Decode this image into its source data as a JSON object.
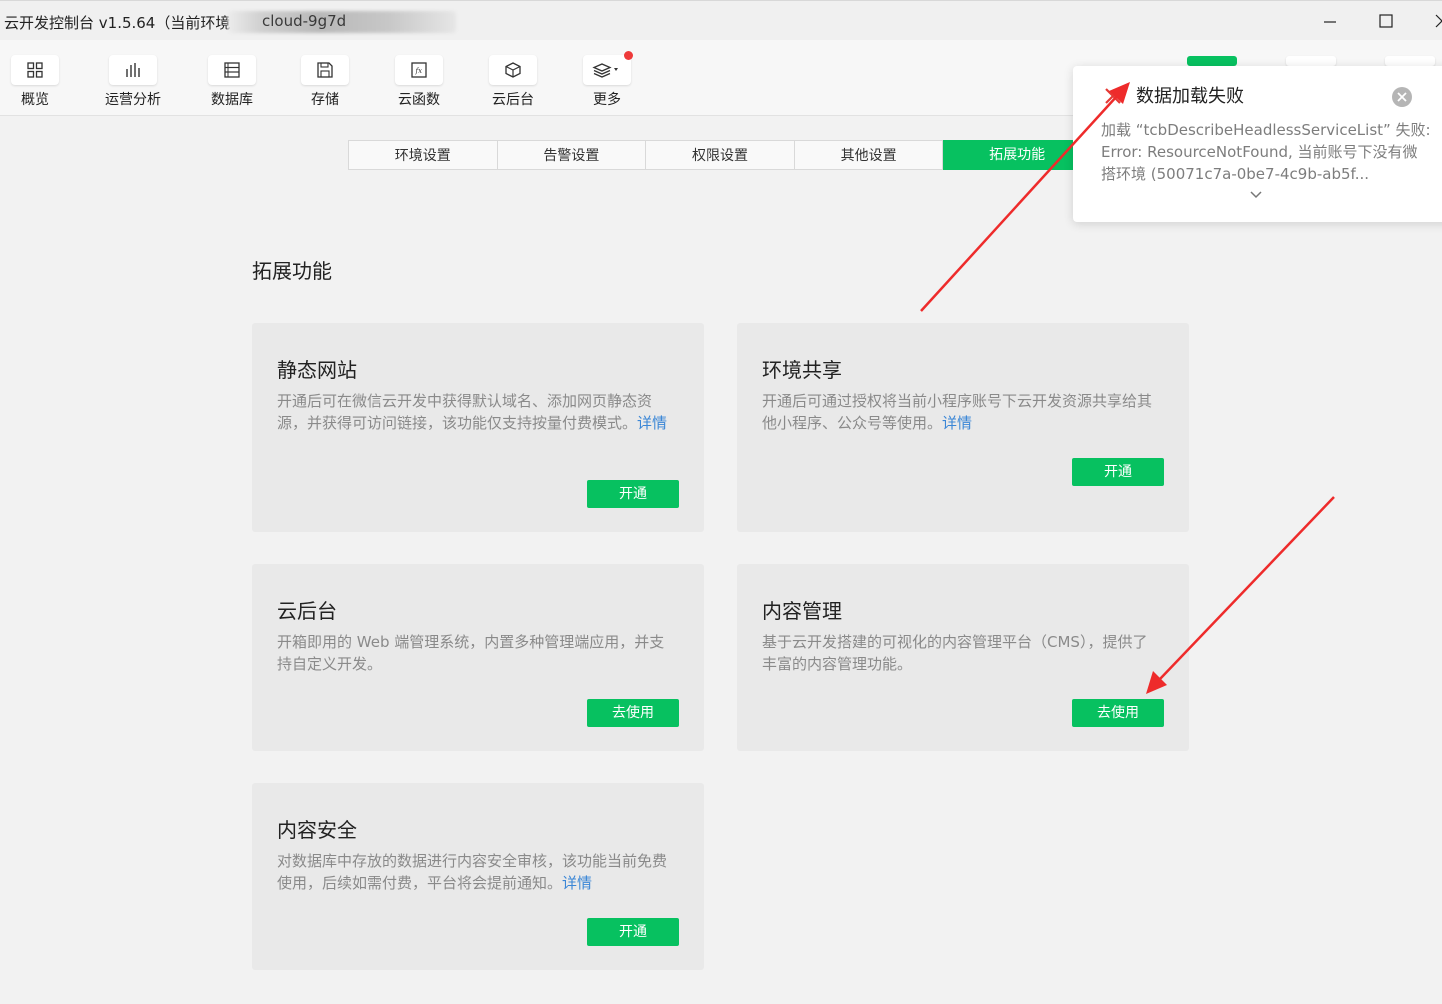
{
  "window": {
    "title": "云开发控制台 v1.5.64（当前环境",
    "env_visible": "cloud-9g7d"
  },
  "toolbar": {
    "items": [
      {
        "label": "概览",
        "icon": "grid-icon"
      },
      {
        "label": "运营分析",
        "icon": "bar-chart-icon"
      },
      {
        "label": "数据库",
        "icon": "database-icon"
      },
      {
        "label": "存储",
        "icon": "save-icon"
      },
      {
        "label": "云函数",
        "icon": "function-icon"
      },
      {
        "label": "云后台",
        "icon": "cube-icon"
      },
      {
        "label": "更多",
        "icon": "layers-icon"
      }
    ]
  },
  "tabs": [
    {
      "label": "环境设置",
      "active": false
    },
    {
      "label": "告警设置",
      "active": false
    },
    {
      "label": "权限设置",
      "active": false
    },
    {
      "label": "其他设置",
      "active": false
    },
    {
      "label": "拓展功能",
      "active": true
    }
  ],
  "section": {
    "title": "拓展功能"
  },
  "cards": {
    "static_site": {
      "title": "静态网站",
      "desc": "开通后可在微信云开发中获得默认域名、添加网页静态资源，并获得可访问链接，该功能仅支持按量付费模式。",
      "link": "详情",
      "button": "开通"
    },
    "env_share": {
      "title": "环境共享",
      "desc": "开通后可通过授权将当前小程序账号下云开发资源共享给其他小程序、公众号等使用。",
      "link": "详情",
      "button": "开通"
    },
    "cloud_backend": {
      "title": "云后台",
      "desc": "开箱即用的 Web 端管理系统，内置多种管理端应用，并支持自定义开发。",
      "button": "去使用"
    },
    "cms": {
      "title": "内容管理",
      "desc": "基于云开发搭建的可视化的内容管理平台（CMS），提供了丰富的内容管理功能。",
      "button": "去使用"
    },
    "content_security": {
      "title": "内容安全",
      "desc": "对数据库中存放的数据进行内容安全审核，该功能当前免费使用，后续如需付费，平台将会提前通知。",
      "link": "详情",
      "button": "开通"
    }
  },
  "toast": {
    "title": "数据加载失败",
    "message": "加载 “tcbDescribeHeadlessServiceList” 失败: Error: ResourceNotFound, 当前账号下没有微搭环境 (50071c7a-0be7-4c9b-ab5f..."
  },
  "colors": {
    "brand_green": "#07c160",
    "error_red": "#e53935",
    "annotation_red": "#ee2b2b",
    "link_blue": "#3a86d6"
  }
}
